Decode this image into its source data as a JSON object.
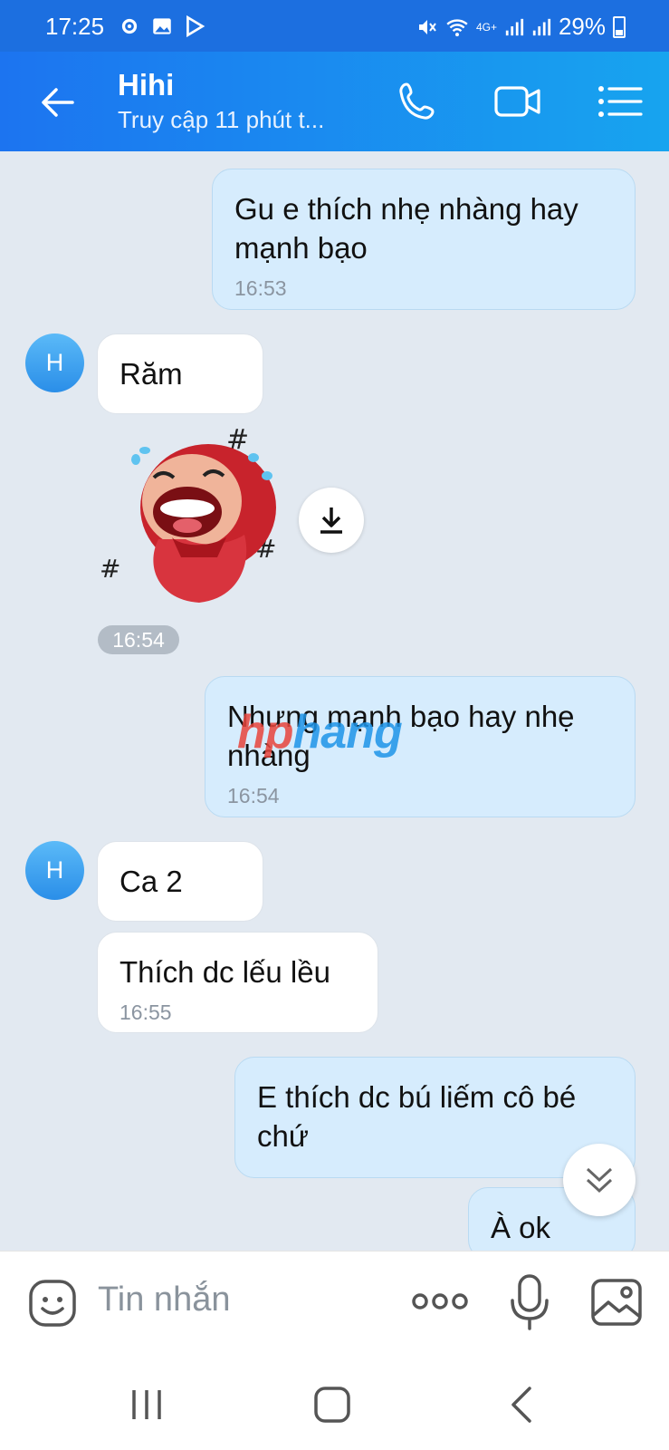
{
  "status_bar": {
    "time": "17:25",
    "network": "4G+",
    "battery": "29%"
  },
  "header": {
    "title": "Hihi",
    "subtitle": "Truy cập 11 phút t..."
  },
  "messages": [
    {
      "text": "Gu e thích nhẹ nhàng hay mạnh bạo",
      "time": "16:53"
    },
    {
      "avatar": "H",
      "text": "Răm"
    },
    {
      "sticker": "sticker-laughing-crying-girl",
      "time": "16:54"
    },
    {
      "text": "Nhưng mạnh bạo hay nhẹ nhàng",
      "time": "16:54"
    },
    {
      "avatar": "H",
      "text": "Ca 2"
    },
    {
      "text": "Thích dc lếu lều",
      "time": "16:55"
    },
    {
      "text": "E thích dc bú liếm cô bé chứ"
    },
    {
      "text": "À ok"
    }
  ],
  "watermark": {
    "part1": "hp",
    "part2": "hang"
  },
  "input": {
    "placeholder": "Tin nhắn"
  },
  "colors": {
    "header_start": "#1c74f0",
    "header_end": "#17a4ef",
    "outgoing_bubble": "#d6ecfd",
    "incoming_bubble": "#ffffff",
    "background": "#e2e9f1"
  }
}
